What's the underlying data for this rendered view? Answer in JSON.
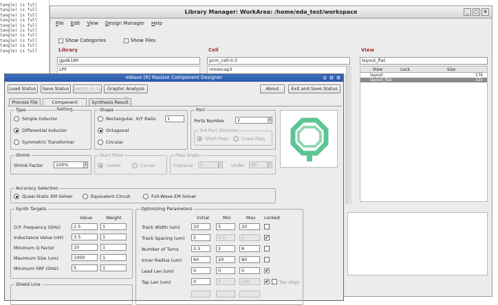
{
  "terminal": {
    "lines": [
      "tangle) is full",
      "tangle) is full",
      "tangle) is full",
      "tangle) is full",
      "tangle) is full",
      "tangle) is full",
      "tangle) is full",
      "tangle) is full",
      "tangle) is full",
      "tangle) is full"
    ]
  },
  "library_manager": {
    "title": "Library Manager: WorkArea: /home/eda_test/workspace",
    "menu": [
      "File",
      "Edit",
      "View",
      "Design Manager",
      "Help"
    ],
    "show_categories": "Show Categories",
    "show_files": "Show Files",
    "library_header": "Library",
    "library_input": "gpdk180",
    "library_items": [
      "LPF"
    ],
    "cell_header": "Cell",
    "cell_input": "pcm_cell-0.5",
    "cell_items": [
      "nmoscap3"
    ],
    "view_header": "View",
    "view_input": "layout_flat",
    "view_columns": [
      "View",
      "Lock",
      "Size"
    ],
    "view_rows": [
      {
        "view": "layout",
        "lock": "",
        "size": "17k"
      },
      {
        "view": "layout_flat",
        "lock": "",
        "size": "32k"
      }
    ]
  },
  "ewave": {
    "title": "eWave (R) Passive Component Designer",
    "toolbar": [
      "Load Status",
      "Save Status",
      "Switch to TL",
      "Graphic Analysis ..."
    ],
    "about": "About",
    "exit_save": "Exit and Save Status",
    "tabs": [
      "Process File",
      "Component Setting",
      "Synthesis Result"
    ],
    "type": {
      "label": "Type",
      "options": [
        "Simple Inductor",
        "Differential Inductor",
        "Symmetric Transformer"
      ],
      "selected": 1
    },
    "shape": {
      "label": "Shape",
      "options": [
        "Rectangular, X/Y Ratio",
        "Octagonal",
        "Circular"
      ],
      "selected": 1,
      "ratio": "1"
    },
    "port": {
      "label": "Port",
      "ports_label": "Ports Number",
      "ports_value": "2",
      "direction_label": "3rd Port Direction",
      "dir_options": [
        "Short Pass",
        "Cross Pass"
      ]
    },
    "shrink": {
      "label": "Shrink",
      "factor_label": "Shrink Factor",
      "factor_value": "100%"
    },
    "start_point": {
      "label": "Start Point",
      "options": [
        "Center",
        "Corner"
      ]
    },
    "pass_angle": {
      "label": "Pass Angle",
      "coplanar_label": "Coplanar",
      "coplanar_value": "0",
      "under_label": "Under",
      "under_value": "90"
    },
    "accuracy": {
      "label": "Accuracy Selection",
      "options": [
        "Quasi-Static EM Solver",
        "Equivalent Circuit",
        "Full-Wave EM Solver"
      ],
      "selected": 0
    },
    "synth": {
      "label": "Synth Targets",
      "col_value": "Value",
      "col_weight": "Weight",
      "rows": [
        {
          "name": "O.P. Frequency (GHz)",
          "value": "2.5",
          "weight": "1"
        },
        {
          "name": "Inductance Value (nH)",
          "value": "3.5",
          "weight": "1"
        },
        {
          "name": "Minimum Q Factor",
          "value": "10",
          "weight": "1"
        },
        {
          "name": "Maximum Size (um)",
          "value": "1000",
          "weight": "1"
        },
        {
          "name": "Minimum SRF (GHz)",
          "value": "5",
          "weight": "1"
        }
      ]
    },
    "shield_label": "Shield Line",
    "params": {
      "label": "Optimizing Parameters",
      "cols": [
        "Initial",
        "Min",
        "Max",
        "Locked"
      ],
      "rows": [
        {
          "name": "Track Width (um)",
          "initial": "10",
          "min": "5",
          "max": "20",
          "locked": false,
          "min_dis": false
        },
        {
          "name": "Track Spacing (um)",
          "initial": "2",
          "min": "1.5",
          "max": "5",
          "locked": true,
          "min_dis": true
        },
        {
          "name": "Number of Turns",
          "initial": "2.5",
          "min": "2",
          "max": "8",
          "locked": false,
          "min_dis": false
        },
        {
          "name": "Inner Radius (um)",
          "initial": "60",
          "min": "20",
          "max": "80",
          "locked": false,
          "min_dis": false
        },
        {
          "name": "Lead Len (um)",
          "initial": "0",
          "min": "0",
          "max": "0",
          "locked": true,
          "min_dis": false
        },
        {
          "name": "Tap Len (um)",
          "initial": "0",
          "min": "0",
          "max": "100",
          "locked": true,
          "min_dis": true
        }
      ],
      "tap_align": "Tap Align"
    }
  },
  "colors": {
    "title_blue": "#2c58a8",
    "preview_green": "#5dc592",
    "select_row": "#8a8a8a"
  }
}
